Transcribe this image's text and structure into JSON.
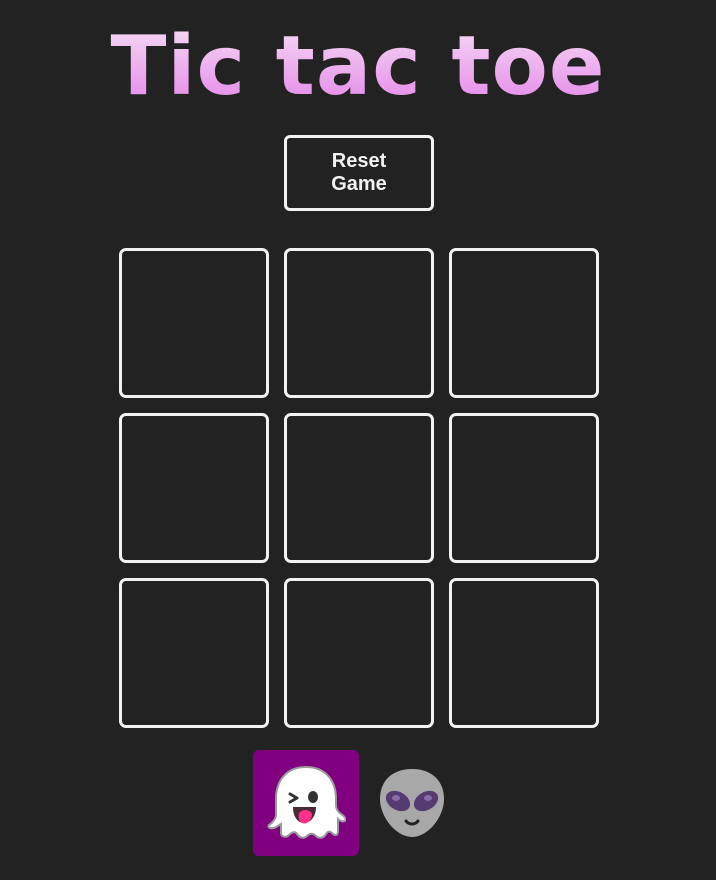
{
  "title": "Tic tac toe",
  "reset_label": "Reset Game",
  "board": {
    "cells": [
      "",
      "",
      "",
      "",
      "",
      "",
      "",
      "",
      ""
    ]
  },
  "players": [
    {
      "icon": "ghost-icon",
      "selected": true
    },
    {
      "icon": "alien-icon",
      "selected": false
    }
  ],
  "colors": {
    "background": "#222222",
    "border": "#f2f2f2",
    "selected_player_bg": "#800080",
    "title_gradient_top": "#f6e7f7",
    "title_gradient_bottom": "#e27ae6"
  }
}
